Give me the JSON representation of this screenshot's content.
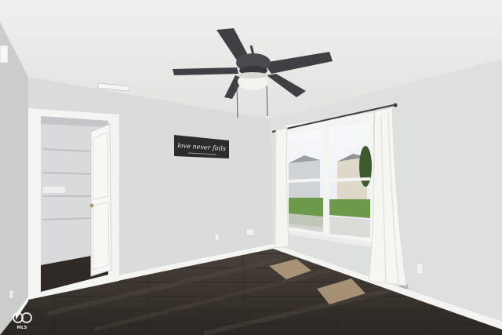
{
  "wall_sign": {
    "text": "love never fails"
  },
  "watermark": {
    "text": "MLS"
  },
  "colors": {
    "ceiling": "#e9e9e7",
    "wall_back": "#dadbdb",
    "wall_left": "#cbcccc",
    "wall_right": "#dedfdf",
    "floor": "#3a342f",
    "trim": "#f4f4f2",
    "fan": "#3f3f44",
    "curtain": "#f4f4f1",
    "grass": "#6c9a4a",
    "sky": "#f3f5f7",
    "sign": "#2b2b2b"
  }
}
